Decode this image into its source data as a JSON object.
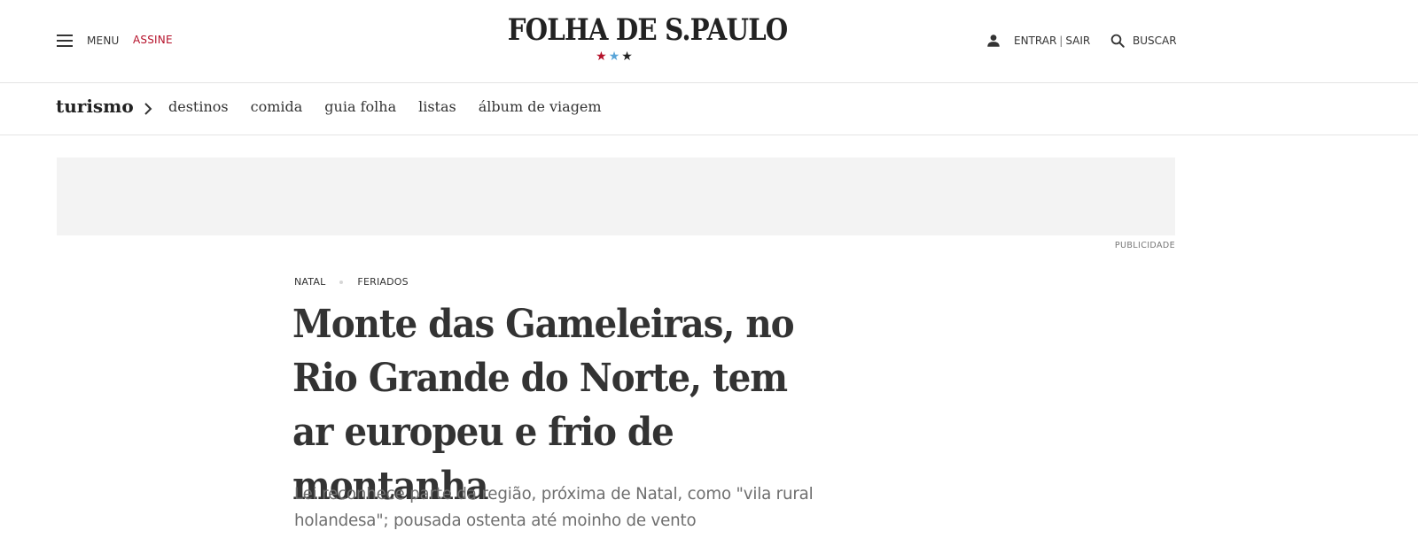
{
  "header": {
    "menu_label": "MENU",
    "assine_label": "ASSINE",
    "logo_text": "FOLHA DE S.PAULO",
    "logo_stars": [
      "★",
      "★",
      "★"
    ],
    "entrar_label": "ENTRAR",
    "separator": "|",
    "sair_label": "SAIR",
    "buscar_label": "BUSCAR",
    "colors": {
      "assine": "#b5112a",
      "star_1": "#b5112a",
      "star_2": "#5aa5d8",
      "star_3": "#222222"
    }
  },
  "section_nav": {
    "title": "turismo",
    "links": [
      "destinos",
      "comida",
      "guia folha",
      "listas",
      "álbum de viagem"
    ]
  },
  "ad": {
    "label": "PUBLICIDADE"
  },
  "article": {
    "kickers": [
      "NATAL",
      "FERIADOS"
    ],
    "headline": "Monte das Gameleiras, no Rio Grande do Norte, tem ar europeu e frio de montanha",
    "subheadline": "Lei reconhece parte da região, próxima de Natal, como \"vila rural holandesa\"; pousada ostenta até moinho de vento"
  }
}
